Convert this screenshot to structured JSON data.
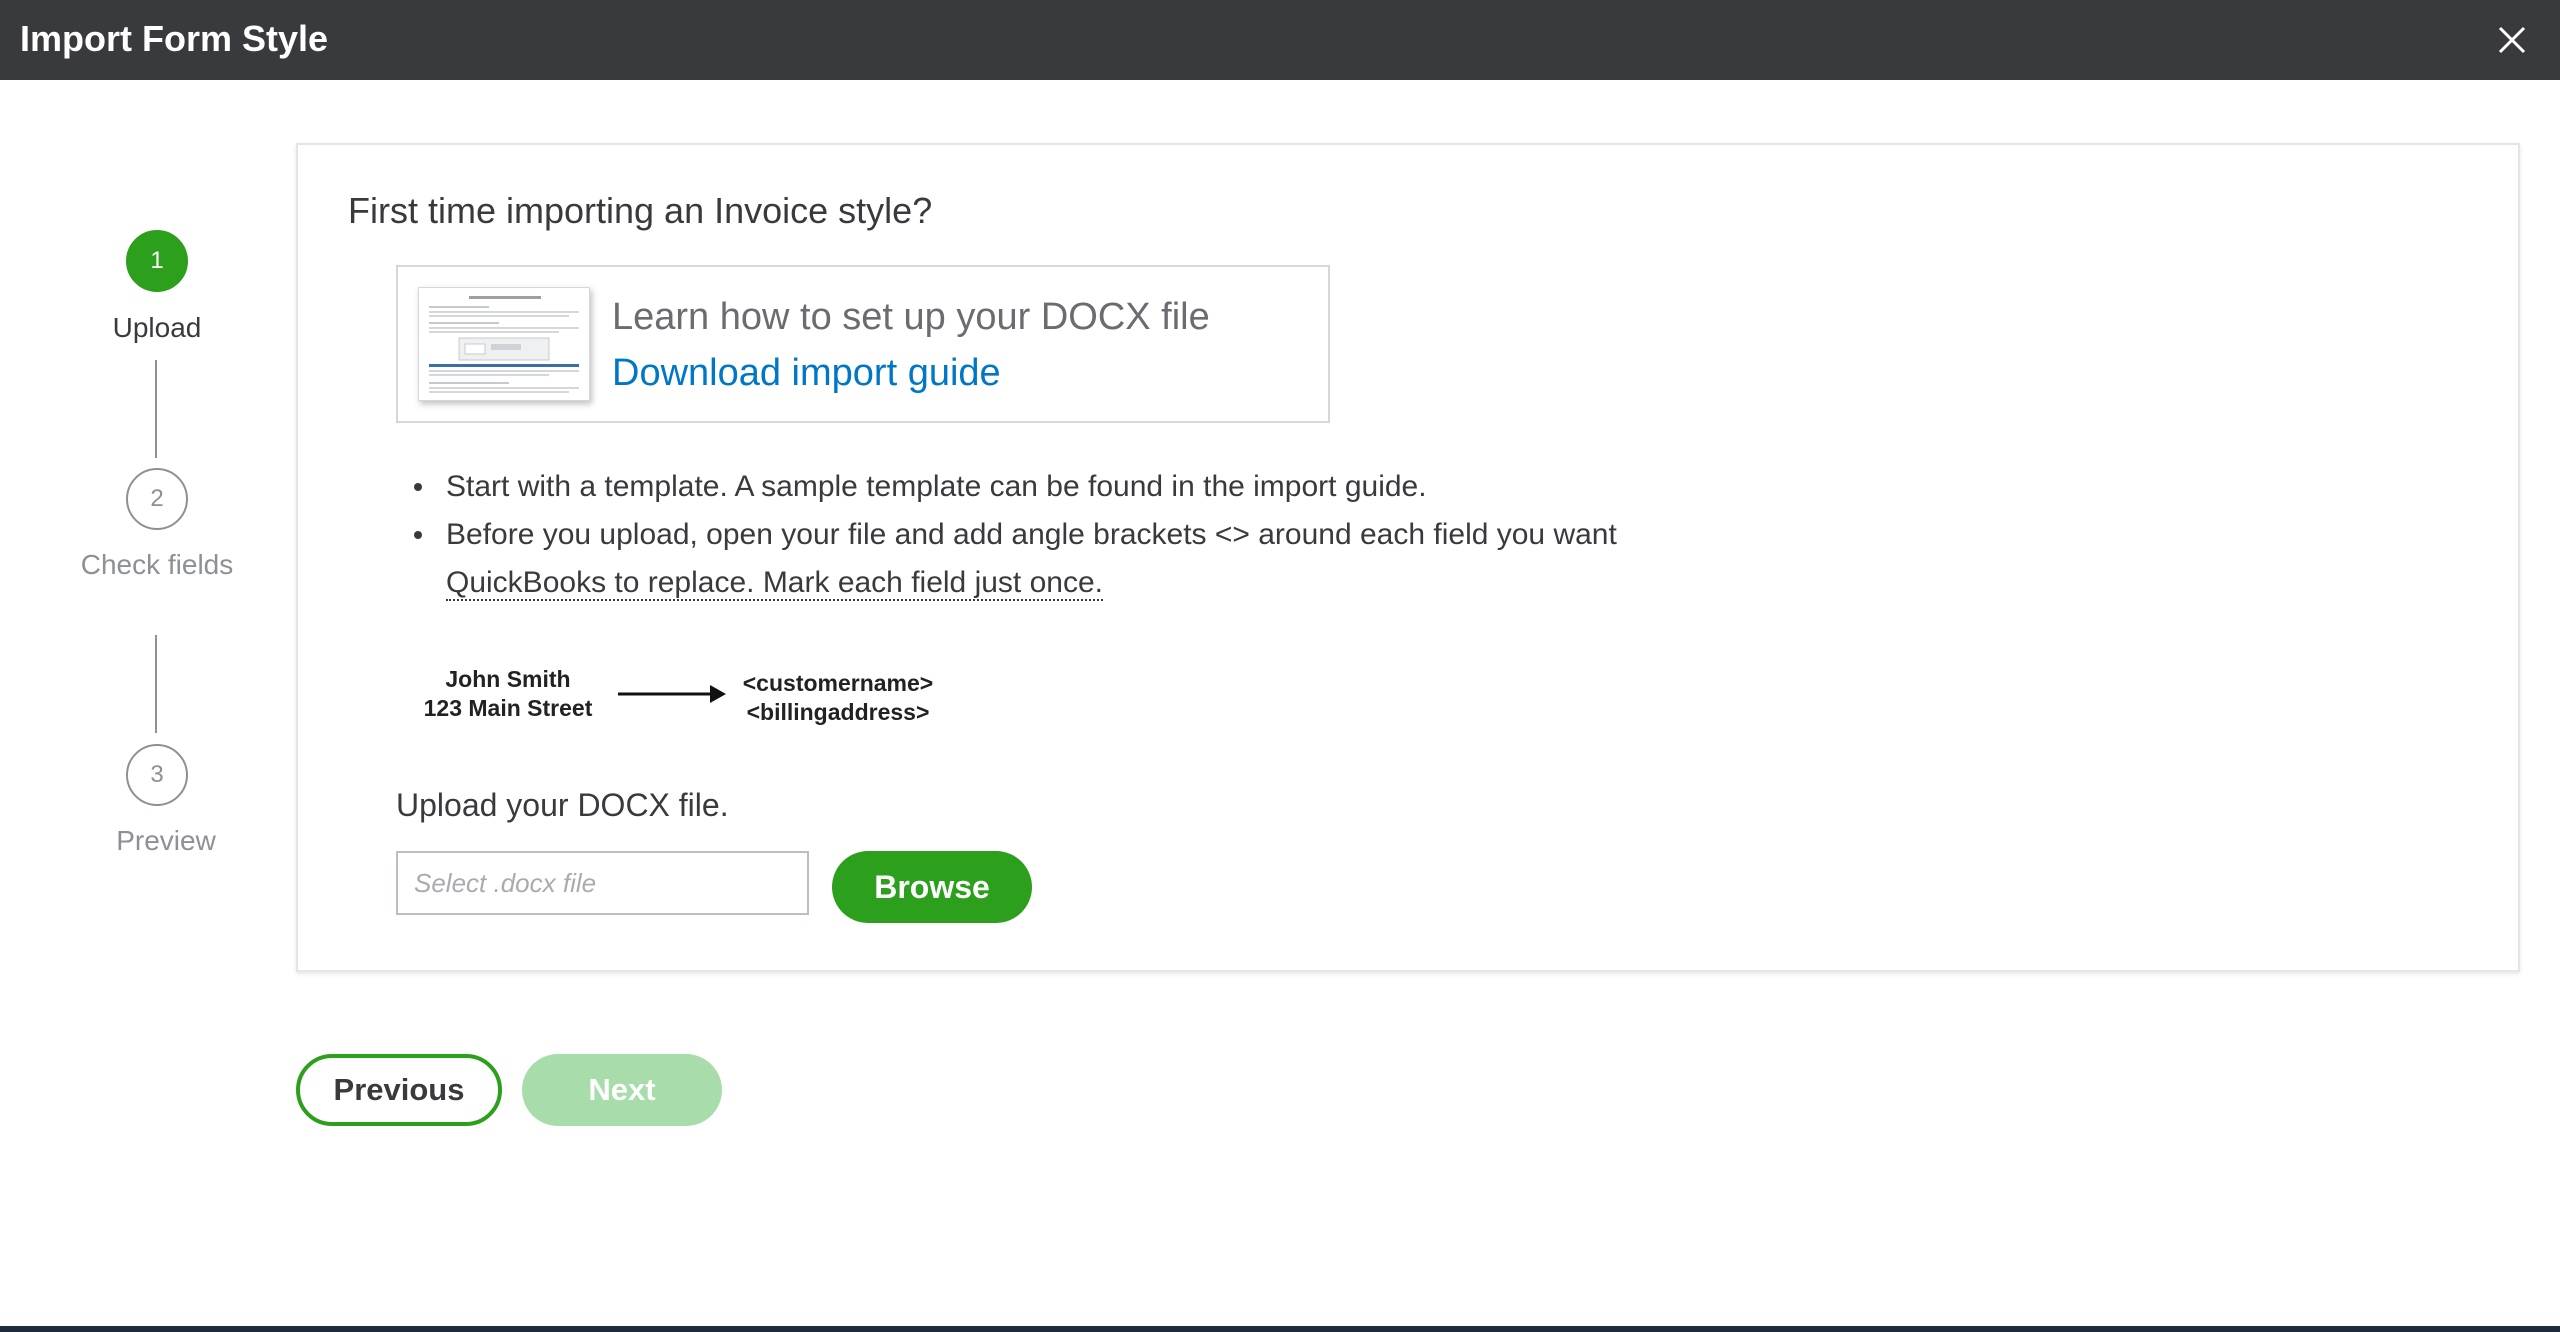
{
  "window": {
    "title": "Import Form Style",
    "close_icon": "close-icon"
  },
  "stepper": {
    "steps": [
      {
        "number": "1",
        "label": "Upload",
        "state": "active"
      },
      {
        "number": "2",
        "label": "Check fields",
        "state": "inactive"
      },
      {
        "number": "3",
        "label": "Preview",
        "state": "inactive"
      }
    ]
  },
  "card": {
    "title": "First time importing an Invoice style?",
    "guide": {
      "text": "Learn how to set up your DOCX file",
      "link": "Download import guide"
    },
    "bullets": [
      "Start with a template. A sample template can be found in the import guide.",
      "Before you upload, open your file and add angle brackets <> around each field you want"
    ],
    "bullet2_continuation": "QuickBooks to replace. Mark each field just once.",
    "example": {
      "left_line1": "John Smith",
      "left_line2": "123 Main Street",
      "right_line1": "<customername>",
      "right_line2": "<billingaddress>"
    },
    "upload": {
      "label": "Upload your DOCX file.",
      "placeholder": "Select .docx file",
      "value": "",
      "browse_label": "Browse"
    }
  },
  "footer": {
    "previous_label": "Previous",
    "next_label": "Next"
  },
  "colors": {
    "accent": "#2ca01c",
    "accent_disabled": "#a8dcaa",
    "link": "#0077c5",
    "titlebar": "#393a3d"
  }
}
